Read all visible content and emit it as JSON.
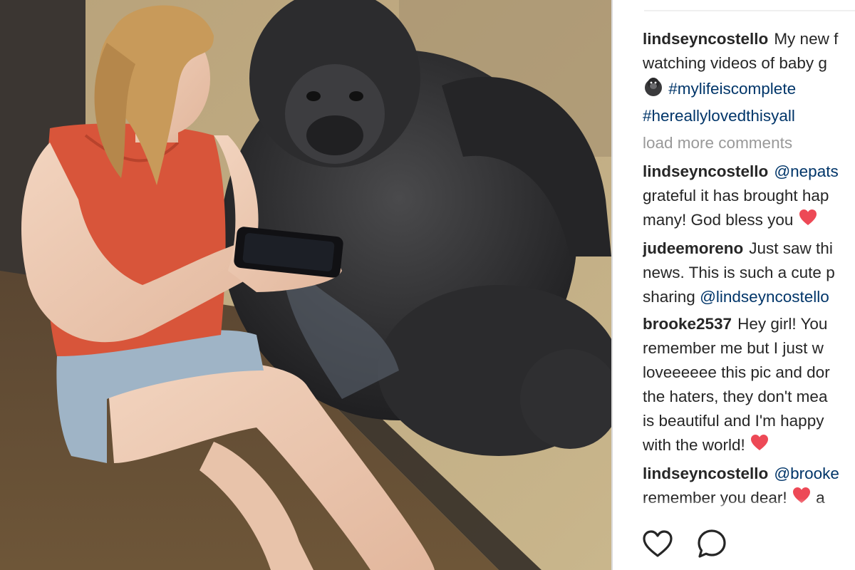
{
  "photo": {
    "alt_subject": "woman-showing-phone-to-gorilla"
  },
  "comments": [
    {
      "user": "lindseyncostello",
      "lines": [
        [
          {
            "t": "text",
            "v": "My new f"
          }
        ],
        [
          {
            "t": "text",
            "v": "watching videos of baby g"
          }
        ],
        [
          {
            "t": "emoji",
            "v": "gorilla-icon"
          },
          {
            "t": "tag",
            "v": "#mylifeiscomplete"
          }
        ],
        [
          {
            "t": "tag",
            "v": "#hereallylovedthisyall"
          }
        ]
      ]
    }
  ],
  "load_more": "load more comments",
  "replies": [
    {
      "user": "lindseyncostello",
      "lines": [
        [
          {
            "t": "tag",
            "v": "@nepats"
          }
        ],
        [
          {
            "t": "text",
            "v": "grateful it has brought hap"
          }
        ],
        [
          {
            "t": "text",
            "v": "many! God bless you"
          },
          {
            "t": "emoji",
            "v": "heart-icon"
          }
        ]
      ]
    },
    {
      "user": "judeemoreno",
      "lines": [
        [
          {
            "t": "text",
            "v": "Just saw thi"
          }
        ],
        [
          {
            "t": "text",
            "v": "news. This is such a cute p"
          }
        ],
        [
          {
            "t": "text",
            "v": "sharing"
          },
          {
            "t": "tag",
            "v": "@lindseyncostello"
          }
        ]
      ]
    },
    {
      "user": "brooke2537",
      "lines": [
        [
          {
            "t": "text",
            "v": "Hey girl! You"
          }
        ],
        [
          {
            "t": "text",
            "v": "remember me but I just w"
          }
        ],
        [
          {
            "t": "text",
            "v": "loveeeeee this pic and dor"
          }
        ],
        [
          {
            "t": "text",
            "v": "the haters, they don't mea"
          }
        ],
        [
          {
            "t": "text",
            "v": "is beautiful and I'm happy"
          }
        ],
        [
          {
            "t": "text",
            "v": "with the world!"
          },
          {
            "t": "emoji",
            "v": "heart-icon"
          }
        ]
      ]
    },
    {
      "user": "lindseyncostello",
      "lines": [
        [
          {
            "t": "tag",
            "v": "@brooke"
          }
        ],
        [
          {
            "t": "text",
            "v": "remember you dear!"
          },
          {
            "t": "emoji",
            "v": "heart-icon"
          },
          {
            "t": "text",
            "v": "a"
          }
        ]
      ]
    }
  ],
  "actions": [
    {
      "name": "like-button",
      "icon": "heart-outline-icon"
    },
    {
      "name": "comment-button",
      "icon": "speech-bubble-icon"
    }
  ],
  "colors": {
    "link": "#003569",
    "muted": "#999999",
    "text": "#262626",
    "heart": "#ed4956"
  }
}
